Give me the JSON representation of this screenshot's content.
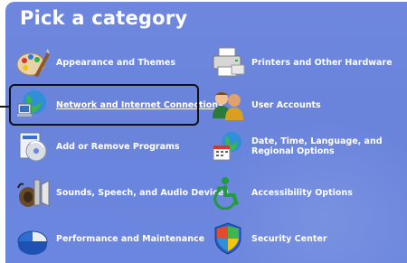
{
  "header": {
    "title": "Pick a category"
  },
  "categories": [
    {
      "label": "Appearance and Themes",
      "icon": "appearance-themes-icon"
    },
    {
      "label": "Printers and Other Hardware",
      "icon": "printers-hardware-icon"
    },
    {
      "label": "Network and Internet Connections",
      "icon": "network-internet-icon",
      "selected": true
    },
    {
      "label": "User Accounts",
      "icon": "user-accounts-icon"
    },
    {
      "label": "Add or Remove Programs",
      "icon": "add-remove-programs-icon"
    },
    {
      "label": "Date, Time, Language, and Regional Options",
      "icon": "date-time-language-icon"
    },
    {
      "label": "Sounds, Speech, and Audio Devices",
      "icon": "sounds-audio-icon"
    },
    {
      "label": "Accessibility Options",
      "icon": "accessibility-icon"
    },
    {
      "label": "Performance and Maintenance",
      "icon": "performance-maintenance-icon"
    },
    {
      "label": "Security Center",
      "icon": "security-center-icon"
    }
  ],
  "colors": {
    "background": "#6b86de",
    "text": "#ffffff",
    "highlight_border": "#111111"
  }
}
